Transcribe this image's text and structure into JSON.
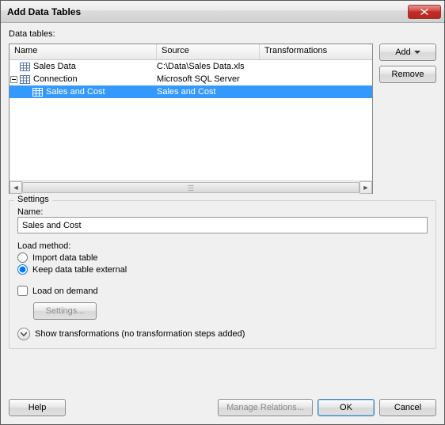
{
  "window": {
    "title": "Add Data Tables"
  },
  "labels": {
    "data_tables": "Data tables:",
    "settings": "Settings",
    "name": "Name:",
    "load_method": "Load method:",
    "import": "Import data table",
    "keep_external": "Keep data table external",
    "load_on_demand": "Load on demand",
    "settings_btn": "Settings...",
    "show_transforms": "Show transformations (no transformation steps added)"
  },
  "columns": {
    "name": "Name",
    "source": "Source",
    "trans": "Transformations"
  },
  "tree": {
    "rows": [
      {
        "name": "Sales Data",
        "source": "C:\\Data\\Sales Data.xls",
        "indent": 0,
        "expander": false,
        "selected": false
      },
      {
        "name": "Connection",
        "source": "Microsoft SQL Server",
        "indent": 0,
        "expander": true,
        "selected": false
      },
      {
        "name": "Sales and Cost",
        "source": "Sales and Cost",
        "indent": 1,
        "expander": false,
        "selected": true
      }
    ]
  },
  "buttons": {
    "add": "Add",
    "remove": "Remove",
    "help": "Help",
    "manage": "Manage Relations...",
    "ok": "OK",
    "cancel": "Cancel"
  },
  "settings_state": {
    "name_value": "Sales and Cost",
    "load_method": "keep_external",
    "load_on_demand": false
  }
}
